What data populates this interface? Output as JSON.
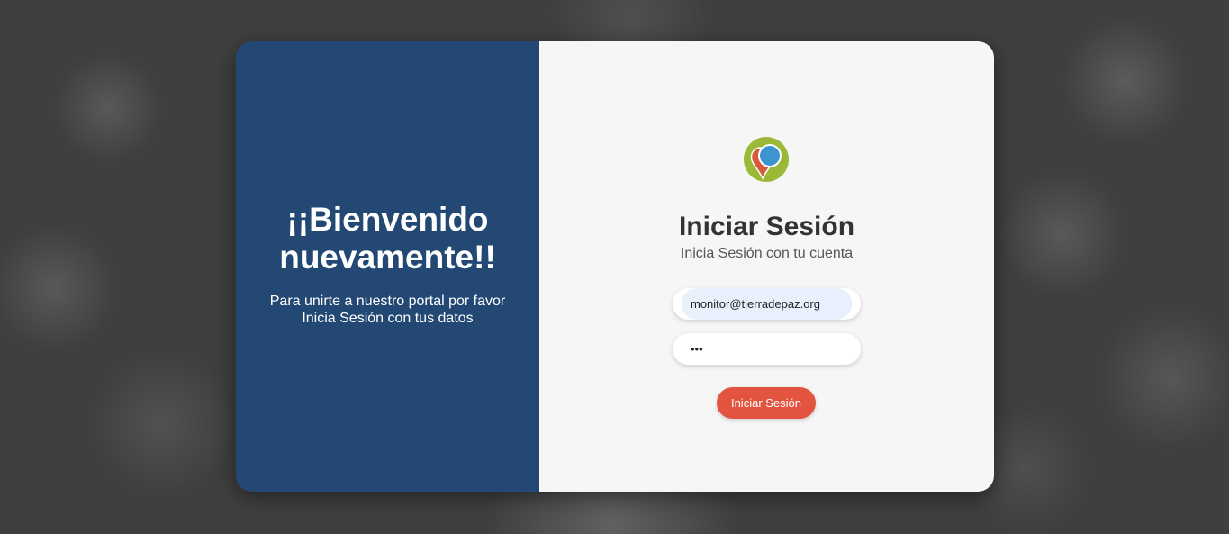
{
  "welcome": {
    "title": "¡¡Bienvenido nuevamente!!",
    "text": "Para unirte a nuestro portal por favor Inicia Sesión con tus datos"
  },
  "login": {
    "logo_icon": "location-pin-logo-icon",
    "title": "Iniciar Sesión",
    "subtitle": "Inicia Sesión con tu cuenta",
    "email_value": "monitor@tierradepaz.org",
    "password_value": "•••",
    "button_label": "Iniciar Sesión"
  },
  "colors": {
    "left_panel": "#234873",
    "right_panel": "#f6f6f6",
    "button": "#e25440",
    "logo_ring": "#9cb838",
    "logo_pin_red": "#d65a3c",
    "logo_pin_blue": "#3d94cf"
  }
}
